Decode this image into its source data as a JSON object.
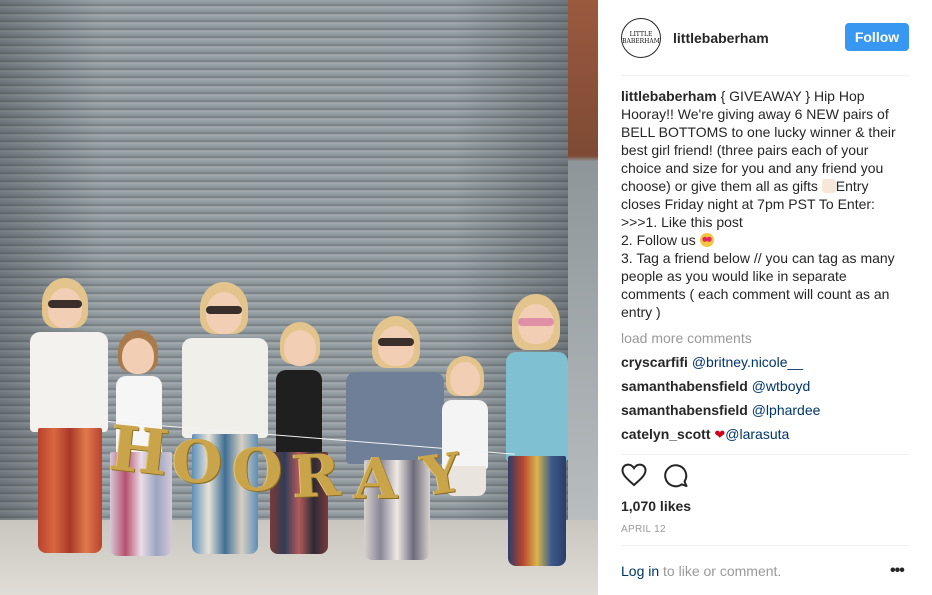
{
  "post": {
    "username": "littlebaberham",
    "avatar_text": "LITTLE BABERHAM",
    "follow_label": "Follow",
    "caption_lines": [
      " { GIVEAWAY } Hip Hop",
      "Hooray!! We're giving away 6 NEW pairs of",
      "BELL BOTTOMS to one lucky winner & their",
      "best girl friend! (three pairs each of your",
      "choice and size for you and any friend you",
      "choose) or give them all as gifts ",
      "Entry",
      "closes Friday night at 7pm PST To Enter:",
      ">>>1. Like this post",
      "2. Follow us ",
      "3. Tag a friend below // you can tag as many",
      "people as you would like in separate",
      "comments ( each comment will count as an",
      "entry )"
    ],
    "load_more": "load more comments",
    "comments": [
      {
        "user": "cryscarfifi",
        "text": "@britney.nicole__"
      },
      {
        "user": "samanthabensfield",
        "text": "@wtboyd"
      },
      {
        "user": "samanthabensfield",
        "text": "@lphardee"
      },
      {
        "user": "catelyn_scott",
        "text": "@larasuta"
      }
    ],
    "likes": "1,070 likes",
    "date": "APRIL 12",
    "login_link": "Log in",
    "login_rest": " to like or comment.",
    "more_label": "•••",
    "banner_text": [
      "H",
      "O",
      "O",
      "R",
      "A",
      "Y"
    ],
    "colors": {
      "follow_bg": "#3897f0",
      "link": "#003569",
      "muted": "#999999"
    },
    "icons": [
      "heart-icon",
      "comment-icon",
      "more-options-icon"
    ]
  }
}
